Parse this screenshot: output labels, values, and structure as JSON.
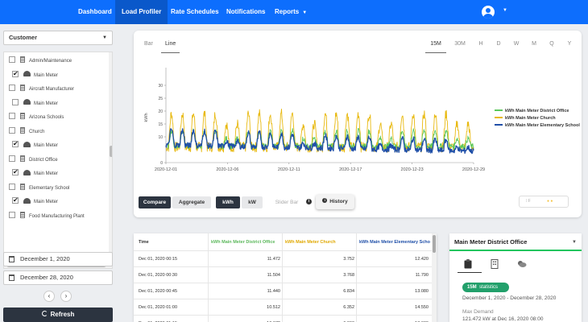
{
  "nav": {
    "items": [
      "Dashboard",
      "Load Profiler",
      "Rate Schedules",
      "Notifications",
      "Reports"
    ]
  },
  "sidebar": {
    "customer_label": "Customer",
    "tree": [
      {
        "label": "Admin/Maintenance",
        "type": "site",
        "checked": false
      },
      {
        "label": "Main Meter",
        "type": "meter",
        "checked": true
      },
      {
        "label": "Aircraft Manufacturer",
        "type": "site",
        "checked": false
      },
      {
        "label": "Main Meter",
        "type": "meter",
        "checked": false
      },
      {
        "label": "Arizona Schools",
        "type": "site",
        "checked": false
      },
      {
        "label": "Church",
        "type": "site",
        "checked": false
      },
      {
        "label": "Main Meter",
        "type": "meter",
        "checked": true
      },
      {
        "label": "District Office",
        "type": "site",
        "checked": false
      },
      {
        "label": "Main Meter",
        "type": "meter",
        "checked": true
      },
      {
        "label": "Elementary School",
        "type": "site",
        "checked": false
      },
      {
        "label": "Main Meter",
        "type": "meter",
        "checked": true
      },
      {
        "label": "Food Manufacturing Plant",
        "type": "site",
        "checked": false
      }
    ],
    "start_date": "December 1, 2020",
    "end_date": "December 28, 2020",
    "prev_label": "‹",
    "next_label": "›",
    "refresh_label": "Refresh"
  },
  "chart_card": {
    "view_tabs": [
      "Bar",
      "Line"
    ],
    "active_view": "Line",
    "range_tabs": [
      "15M",
      "30M",
      "H",
      "D",
      "W",
      "M",
      "Q",
      "Y"
    ],
    "active_range": "15M",
    "buttons": {
      "compare": "Compare",
      "aggregate": "Aggregate",
      "kwh": "kWh",
      "kw": "kW",
      "slider_bar": "Slider Bar",
      "history": "History",
      "info": "i",
      "mini_left": "⁞ F",
      "mini_right": "● ●"
    }
  },
  "chart_data": {
    "type": "line",
    "ylabel": "kWh",
    "ylim": [
      0,
      35
    ],
    "yticks": [
      0,
      10,
      15,
      20,
      25,
      30
    ],
    "xticks": [
      "2020-12-01",
      "2020-12-06",
      "2020-12-11",
      "2020-12-17",
      "2020-12-23",
      "2020-12-29"
    ],
    "xrange": [
      0,
      28
    ],
    "legend_position": "right",
    "series": [
      {
        "name": "kWh Main Meter District Office",
        "color": "#5cc85c",
        "base": 11.5,
        "amp": 6,
        "amp2": 3
      },
      {
        "name": "kWh Main Meter Church",
        "color": "#e8b90f",
        "base": 11,
        "amp": 13,
        "amp2": 9
      },
      {
        "name": "kWh Main Meter Elementary School",
        "color": "#1f4fa8",
        "base": 12.5,
        "amp": 6,
        "amp2": 2
      }
    ]
  },
  "table": {
    "columns": [
      "Time",
      "kWh Main Meter District Office",
      "kWh Main Meter Church",
      "kWh Main Meter Elementary School"
    ],
    "rows": [
      [
        "Dec 01, 2020 00:15",
        "11.472",
        "3.752",
        "12.420"
      ],
      [
        "Dec 01, 2020 00:30",
        "11.504",
        "3.768",
        "11.790"
      ],
      [
        "Dec 01, 2020 00:45",
        "11.440",
        "6.834",
        "13.080"
      ],
      [
        "Dec 01, 2020 01:00",
        "10.512",
        "6.352",
        "14.550"
      ],
      [
        "Dec 01, 2020 01:15",
        "10.672",
        "6.000",
        "13.680"
      ]
    ]
  },
  "stats": {
    "title": "Main Meter District Office",
    "badge_interval": "15M",
    "badge_label": "statistics",
    "date_range": "December 1, 2020 - December 28, 2020",
    "max_demand_label": "Max Demand",
    "max_demand_value": "121.472 kW at Dec 16, 2020 08:00"
  }
}
